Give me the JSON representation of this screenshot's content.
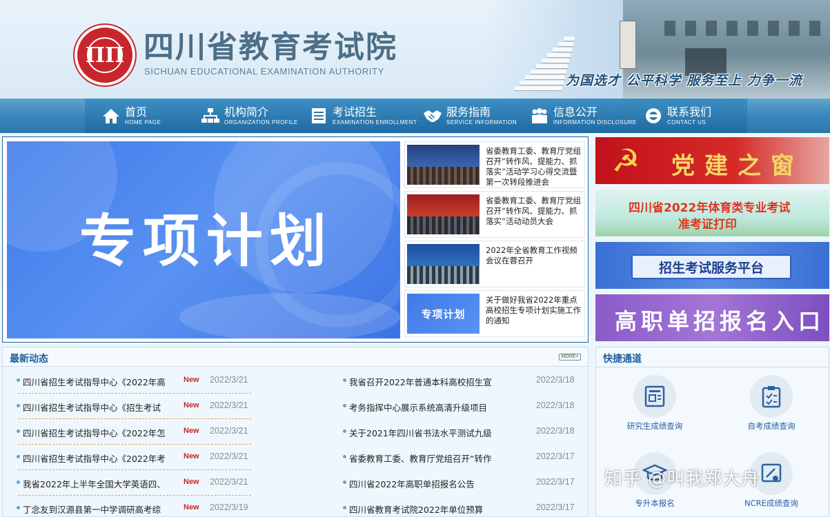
{
  "header": {
    "site_name": "四川省教育考试院",
    "site_name_en": "SICHUAN EDUCATIONAL EXAMINATION AUTHORITY",
    "slogan": "为国选才 公平科学 服务至上 力争一流"
  },
  "nav": [
    {
      "cn": "首页",
      "en": "HOME PAGE",
      "icon": "home-icon"
    },
    {
      "cn": "机构简介",
      "en": "ORGANIZATION PROFILE",
      "icon": "org-chart-icon"
    },
    {
      "cn": "考试招生",
      "en": "EXAMINATION ENROLLMENT",
      "icon": "document-list-icon"
    },
    {
      "cn": "服务指南",
      "en": "SERVICE INFORMATION",
      "icon": "handshake-icon"
    },
    {
      "cn": "信息公开",
      "en": "INFORMATION DISCLOSURE",
      "icon": "people-icon"
    },
    {
      "cn": "联系我们",
      "en": "CONTACT US",
      "icon": "contact-icon"
    }
  ],
  "feature": {
    "banner_title": "专项计划",
    "news": [
      {
        "headline": "省委教育工委、教育厅党组召开“转作风、提能力、抓落实”活动学习心得交流暨第一次转段推进会"
      },
      {
        "headline": "省委教育工委、教育厅党组召开“转作风、提能力、抓落实”活动动员大会"
      },
      {
        "headline": "2022年全省教育工作视频会议在蓉召开"
      },
      {
        "headline": "关于做好我省2022年重点高校招生专项计划实施工作的通知",
        "thumb_text": "专项计划"
      }
    ]
  },
  "side_banners": {
    "party": "党建之窗",
    "sports_line1": "四川省2022年体育类专业考试",
    "sports_line2": "准考证打印",
    "platform": "招生考试服务平台",
    "vocational": "高职单招报名入口"
  },
  "latest": {
    "title": "最新动态",
    "more": "MORE+",
    "new_label": "New",
    "left": [
      {
        "title": "四川省招生考试指导中心《2022年高",
        "date": "2022/3/21",
        "is_new": true
      },
      {
        "title": "四川省招生考试指导中心《招生考试",
        "date": "2022/3/21",
        "is_new": true
      },
      {
        "title": "四川省招生考试指导中心《2022年怎",
        "date": "2022/3/21",
        "is_new": true
      },
      {
        "title": "四川省招生考试指导中心《2022年考",
        "date": "2022/3/21",
        "is_new": true
      },
      {
        "title": "我省2022年上半年全国大学英语四、",
        "date": "2022/3/21",
        "is_new": true
      },
      {
        "title": "丁念友到汉源县第一中学调研高考综",
        "date": "2022/3/19",
        "is_new": true
      }
    ],
    "right": [
      {
        "title": "我省召开2022年普通本科高校招生宣",
        "date": "2022/3/18"
      },
      {
        "title": "考务指挥中心展示系统高清升级项目",
        "date": "2022/3/18"
      },
      {
        "title": "关于2021年四川省书法水平测试九级",
        "date": "2022/3/18"
      },
      {
        "title": "省委教育工委、教育厅党组召开“转作",
        "date": "2022/3/17"
      },
      {
        "title": "四川省2022年高职单招报名公告",
        "date": "2022/3/17"
      },
      {
        "title": "四川省教育考试院2022年单位预算",
        "date": "2022/3/17"
      }
    ]
  },
  "quick": {
    "title": "快捷通道",
    "items": [
      {
        "label": "研究生成绩查询",
        "icon": "id-card-icon"
      },
      {
        "label": "自考成绩查询",
        "icon": "clipboard-check-icon"
      },
      {
        "label": "专升本报名",
        "icon": "graduation-cap-icon"
      },
      {
        "label": "NCRE成绩查询",
        "icon": "certificate-icon"
      }
    ]
  },
  "watermark": "知乎 @叫我郑大舟",
  "colors": {
    "nav_blue": "#2f77ab",
    "heading_blue": "#1f5f9f",
    "new_red": "#c8262d",
    "banner_blue": "#4a85ee"
  }
}
